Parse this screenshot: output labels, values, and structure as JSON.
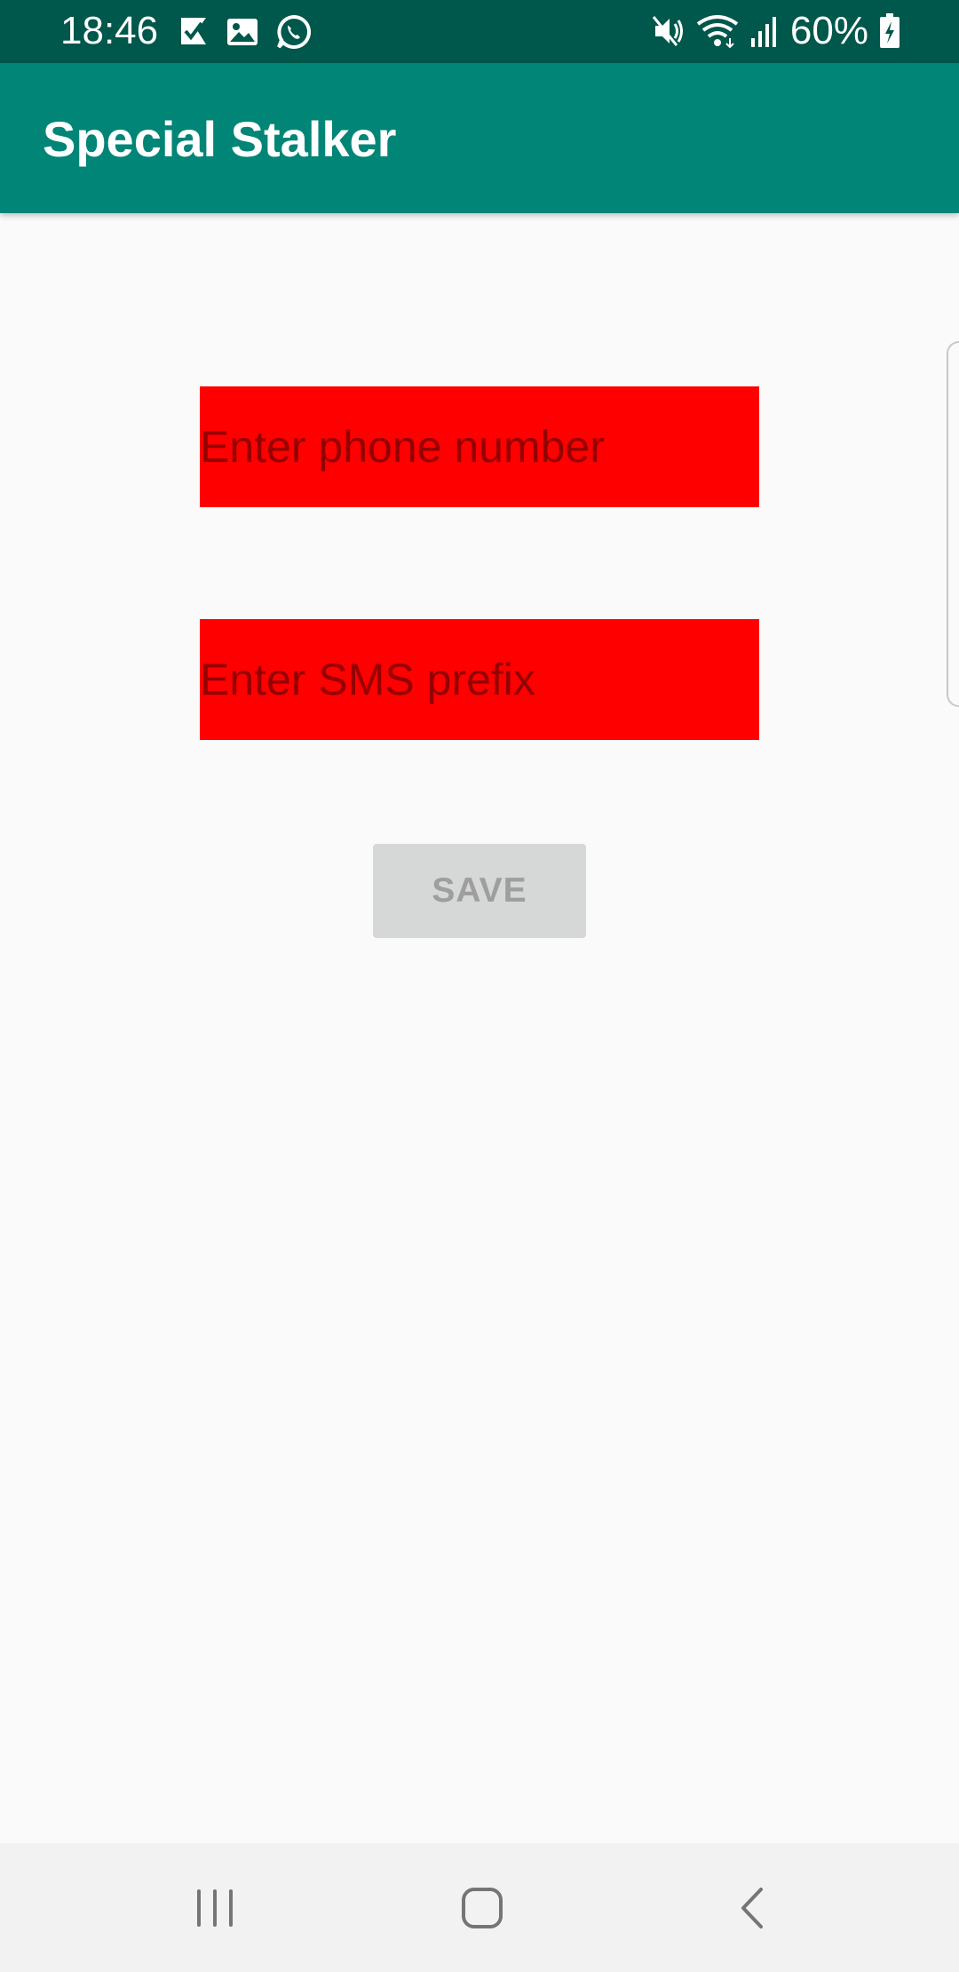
{
  "status_bar": {
    "time": "18:46",
    "battery_percent": "60%",
    "left_icons": [
      "check-flag-icon",
      "gallery-icon",
      "whatsapp-icon"
    ],
    "right_icons": [
      "mute-icon",
      "wifi-icon",
      "signal-icon",
      "battery-charging-icon"
    ],
    "color": "#00574b"
  },
  "app_bar": {
    "title": "Special Stalker",
    "color": "#008577"
  },
  "form": {
    "phone_placeholder": "Enter phone number",
    "prefix_placeholder": "Enter SMS prefix",
    "phone_value": "",
    "prefix_value": "",
    "field_color": "#ff0000",
    "save_label": "SAVE"
  },
  "nav_bar": {
    "buttons": [
      "recents-icon",
      "home-icon",
      "back-icon"
    ]
  }
}
